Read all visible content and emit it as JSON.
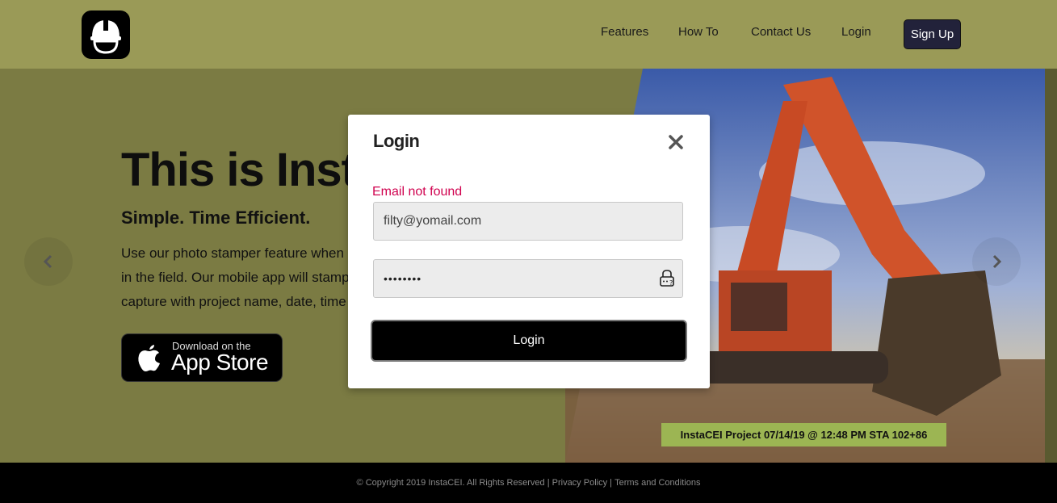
{
  "nav": {
    "links": [
      "Features",
      "How To",
      "Contact Us",
      "Login"
    ],
    "signup_label": "Sign Up"
  },
  "hero": {
    "title": "This is InstaCEI",
    "subtitle": "Simple. Time Efficient.",
    "lines": [
      "Use our photo stamper feature when",
      "in the field. Our mobile app will stamp",
      "capture with project name, date, time"
    ],
    "store_small": "Download on the",
    "store_big": "App Store",
    "photo_caption": "InstaCEI Project 07/14/19 @ 12:48 PM STA 102+86"
  },
  "footer": {
    "copyright": "© Copyright 2019 InstaCEI. All Rights Reserved |",
    "privacy": "Privacy Policy",
    "sep": "|",
    "terms": "Terms and Conditions"
  },
  "modal": {
    "title": "Login",
    "error": "Email not found",
    "email_value": "filty@yomail.com",
    "password_mask": "••••••••",
    "submit_label": "Login"
  },
  "colors": {
    "brand_olive": "#9a9a57",
    "error": "#d0024f",
    "caption_bg": "#9cb553"
  }
}
